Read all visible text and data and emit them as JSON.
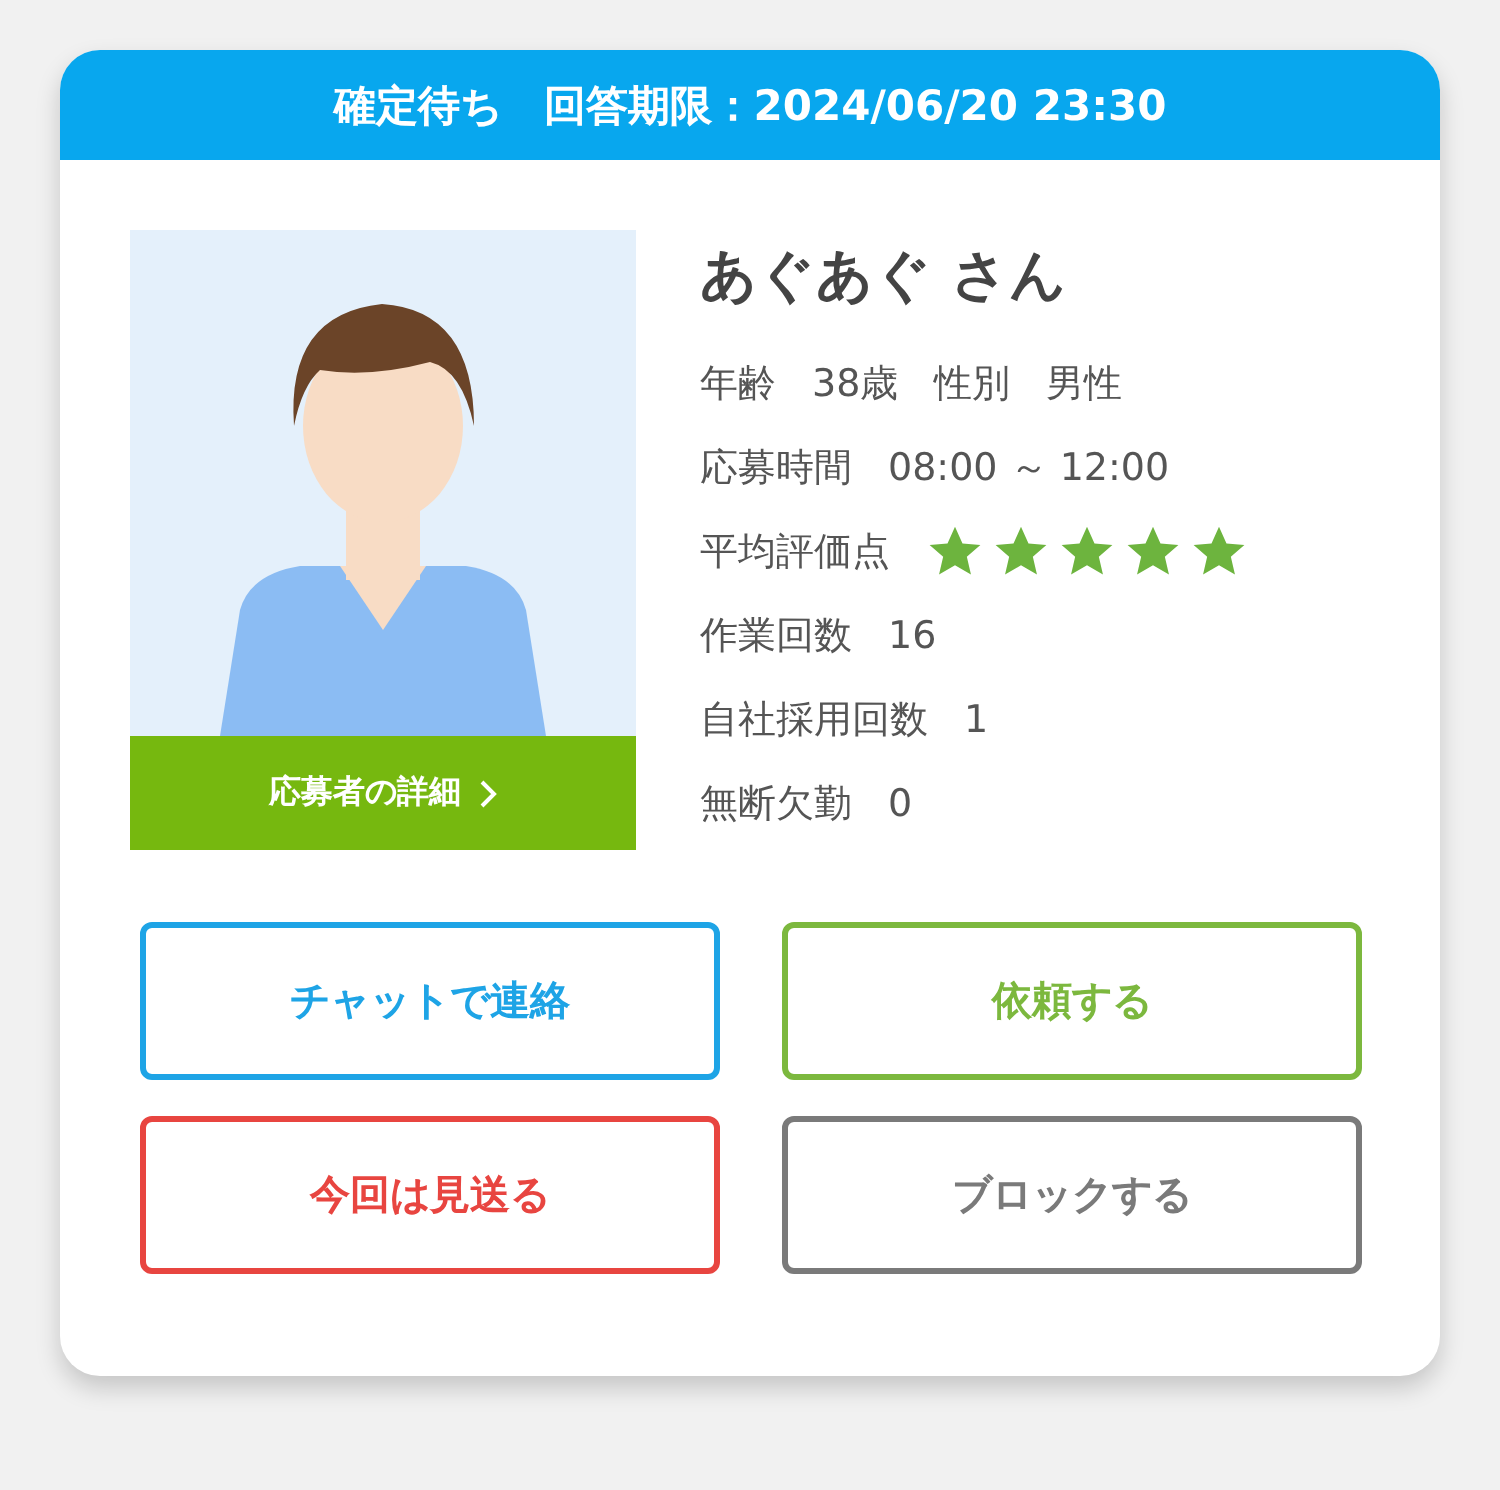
{
  "header": {
    "status": "確定待ち",
    "deadline": "回答期限：2024/06/20 23:30"
  },
  "applicant": {
    "name": "あぐあぐ さん",
    "detail_link": "応募者の詳細"
  },
  "info_rows": [
    {
      "kind": "pairs",
      "items": [
        {
          "label": "年齢",
          "value": "38歳"
        },
        {
          "label": "性別",
          "value": "男性"
        }
      ]
    },
    {
      "kind": "pairs",
      "items": [
        {
          "label": "応募時間",
          "value": "08:00 ～ 12:00"
        }
      ]
    },
    {
      "kind": "stars",
      "label": "平均評価点",
      "stars": 5
    },
    {
      "kind": "pairs",
      "items": [
        {
          "label": "作業回数",
          "value": "16"
        }
      ]
    },
    {
      "kind": "pairs",
      "items": [
        {
          "label": "自社採用回数",
          "value": "1"
        }
      ]
    },
    {
      "kind": "pairs",
      "items": [
        {
          "label": "無断欠勤",
          "value": "0"
        }
      ]
    }
  ],
  "buttons": [
    {
      "label": "チャットで連絡",
      "color": "#1ea4e6"
    },
    {
      "label": "依頼する",
      "color": "#7cb83e"
    },
    {
      "label": "今回は見送る",
      "color": "#e84540"
    },
    {
      "label": "ブロックする",
      "color": "#7a7a7a"
    }
  ]
}
